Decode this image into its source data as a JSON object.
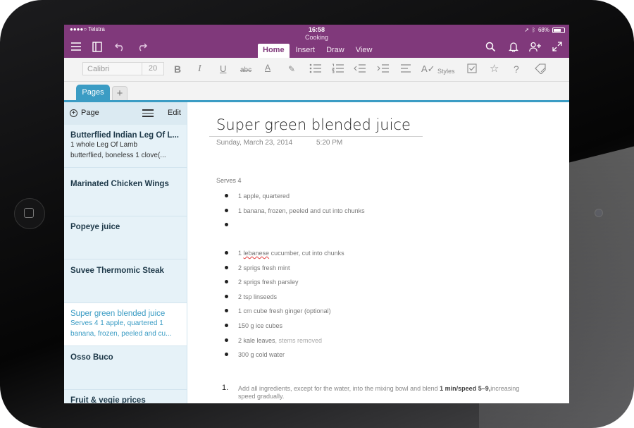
{
  "status_bar": {
    "carrier": "●●●●○ Telstra",
    "time": "16:58",
    "battery": "68%"
  },
  "header": {
    "notebook": "Cooking",
    "tabs": [
      {
        "label": "Home",
        "active": true
      },
      {
        "label": "Insert",
        "active": false
      },
      {
        "label": "Draw",
        "active": false
      },
      {
        "label": "View",
        "active": false
      }
    ]
  },
  "toolbar": {
    "font_name": "Calibri",
    "font_size": "20",
    "styles_label": "Styles"
  },
  "sections": {
    "pages_tab": "Pages",
    "add_tab": "+"
  },
  "sidebar": {
    "add_page_label": "Page",
    "edit_label": "Edit",
    "items": [
      {
        "title": "Butterflied Indian Leg Of L...",
        "preview1": "1  whole  Leg Of Lamb",
        "preview2": "butterflied, boneless  1  clove(..."
      },
      {
        "title": "Marinated Chicken Wings",
        "preview1": "",
        "preview2": ""
      },
      {
        "title": "Popeye juice",
        "preview1": "",
        "preview2": ""
      },
      {
        "title": "Suvee Thermomic Steak",
        "preview1": "",
        "preview2": ""
      },
      {
        "title": "Super green blended juice",
        "preview1": "Serves 4   1 apple, quartered   1",
        "preview2": "banana, frozen, peeled and cu..."
      },
      {
        "title": "Osso Buco",
        "preview1": "",
        "preview2": ""
      },
      {
        "title": "Fruit & vegie prices",
        "preview1": "",
        "preview2": ""
      }
    ]
  },
  "page": {
    "title": "Super green blended juice",
    "date": "Sunday, March 23, 2014",
    "time": "5:20 PM",
    "serves": "Serves 4",
    "ingredients": [
      "1 apple, quartered",
      "1 banana, frozen, peeled and cut into chunks",
      "",
      "1 lebanese cucumber, cut into chunks",
      "2 sprigs fresh mint",
      "2 sprigs fresh parsley",
      "2 tsp linseeds",
      "1 cm cube fresh ginger (optional)",
      "150 g ice cubes",
      "2 kale leaves",
      "300 g cold water"
    ],
    "ingredient_extra": ", stems removed",
    "cucumber_pre": "1 ",
    "cucumber_word": "lebanese",
    "cucumber_post": " cucumber, cut into chunks",
    "step_number": "1.",
    "step_pre": "Add all ingredients, except for the water, into the mixing bowl and blend ",
    "step_bold": "1 min/speed 5–9,",
    "step_post": "increasing speed gradually."
  },
  "colors": {
    "brand": "#80397b",
    "accent": "#3b9cc4"
  }
}
